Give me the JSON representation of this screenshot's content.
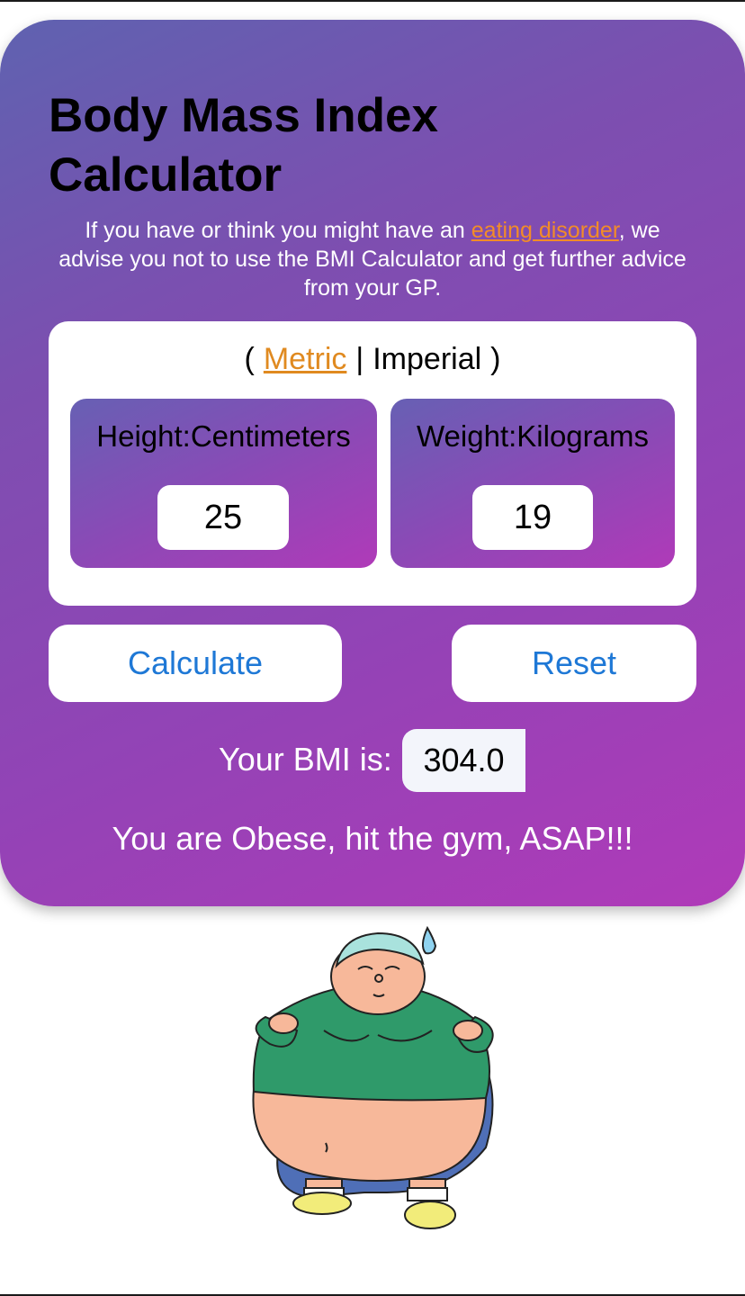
{
  "app": {
    "title_line1": "Body Mass Index",
    "title_line2": "Calculator"
  },
  "disclaimer": {
    "before": "If you have or think you might have an ",
    "link_text": "eating disorder",
    "after": ", we advise you not to use the BMI Calculator and get further advice from your GP."
  },
  "units": {
    "open_paren": "(",
    "metric": "Metric",
    "separator": "|",
    "imperial": "Imperial",
    "close_paren": ")",
    "selected": "Metric"
  },
  "height": {
    "label": "Height:Centimeters",
    "value": "25"
  },
  "weight": {
    "label": "Weight:Kilograms",
    "value": "19"
  },
  "buttons": {
    "calculate": "Calculate",
    "reset": "Reset"
  },
  "result": {
    "label": "Your BMI is:",
    "value": "304.0",
    "verdict": "You are Obese, hit the gym, ASAP!!!"
  },
  "illustration": {
    "icon": "obese-cartoon-character-icon"
  },
  "colors": {
    "gradient_start": "#5f62b0",
    "gradient_end": "#b03ab8",
    "link_orange": "#e08a20",
    "button_text_blue": "#1e78d6"
  }
}
